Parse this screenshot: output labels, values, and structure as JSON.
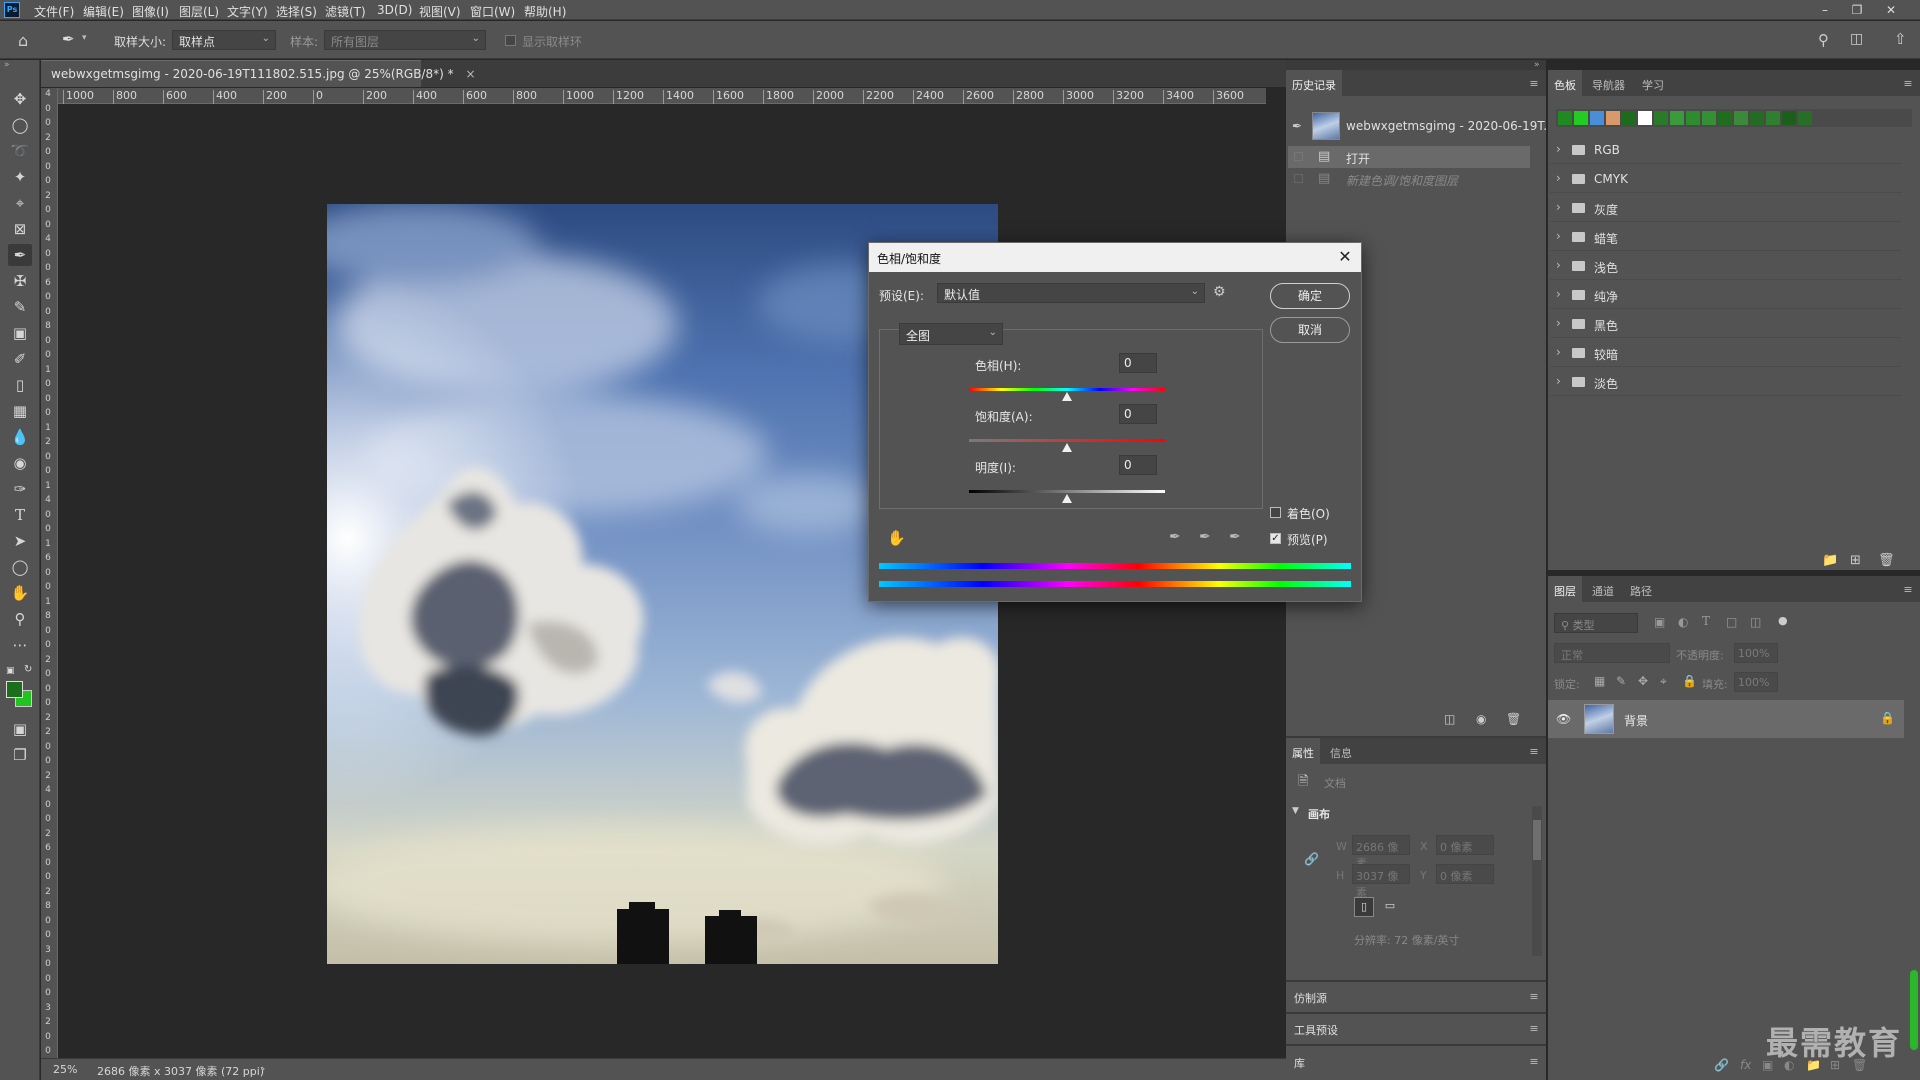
{
  "menubar": {
    "app_logo": "Ps",
    "items": [
      "文件(F)",
      "编辑(E)",
      "图像(I)",
      "图层(L)",
      "文字(Y)",
      "选择(S)",
      "滤镜(T)",
      "3D(D)",
      "视图(V)",
      "窗口(W)",
      "帮助(H)"
    ]
  },
  "options_bar": {
    "sample_size_label": "取样大小:",
    "sample_size_value": "取样点",
    "sample_label": "样本:",
    "sample_value": "所有图层",
    "show_ring_label": "显示取样环"
  },
  "document": {
    "tab_title": "webwxgetmsgimg - 2020-06-19T111802.515.jpg @ 25%(RGB/8*) *",
    "close_glyph": "×",
    "ruler_h_labels": [
      "1000",
      "800",
      "600",
      "400",
      "200",
      "0",
      "200",
      "400",
      "600",
      "800",
      "1000",
      "1200",
      "1400",
      "1600",
      "1800",
      "2000",
      "2200",
      "2400",
      "2600",
      "2800",
      "3000",
      "3200",
      "3400",
      "3600"
    ],
    "ruler_v_labels": [
      "4",
      "0",
      "0",
      "2",
      "0",
      "0",
      "0",
      "2",
      "0",
      "0",
      "4",
      "0",
      "0",
      "6",
      "0",
      "0",
      "8",
      "0",
      "0",
      "1",
      "0",
      "0",
      "0",
      "1",
      "2",
      "0",
      "0",
      "1",
      "4",
      "0",
      "0",
      "1",
      "6",
      "0",
      "0",
      "1",
      "8",
      "0",
      "0",
      "2",
      "0",
      "0",
      "0",
      "2",
      "2",
      "0",
      "0",
      "2",
      "4",
      "0",
      "0",
      "2",
      "6",
      "0",
      "0",
      "2",
      "8",
      "0",
      "0",
      "3",
      "0",
      "0",
      "0",
      "3",
      "2",
      "0",
      "0"
    ]
  },
  "status": {
    "zoom": "25%",
    "doc_info": "2686 像素 x 3037 像素 (72 ppi)"
  },
  "history_panel": {
    "tab": "历史记录",
    "snapshot_name": "webwxgetmsgimg - 2020-06-19T...",
    "steps": [
      "打开",
      "新建色调/饱和度图层"
    ]
  },
  "swatches_panel": {
    "tabs": [
      "色板",
      "导航器",
      "学习"
    ],
    "recent_colors": [
      "#1f8a1f",
      "#22cc22",
      "#4a8fd6",
      "#d89a6a",
      "#1d6b1d",
      "#ffffff",
      "#2a7a2a",
      "#3b9a3b",
      "#2e8b2e",
      "#358f35",
      "#1e6e1e",
      "#3a8a3a",
      "#246c24",
      "#2f7f2f",
      "#1b5f1b",
      "#276f27"
    ],
    "groups": [
      "RGB",
      "CMYK",
      "灰度",
      "蜡笔",
      "浅色",
      "纯净",
      "黑色",
      "较暗",
      "淡色"
    ]
  },
  "layers_panel": {
    "tabs": [
      "图层",
      "通道",
      "路径"
    ],
    "filter_placeholder": "类型",
    "blend_mode": "正常",
    "opacity_label": "不透明度:",
    "opacity_value": "100%",
    "lock_label": "锁定:",
    "fill_label": "填充:",
    "fill_value": "100%",
    "layer_name": "背景"
  },
  "properties_panel": {
    "tabs": [
      "属性",
      "信息"
    ],
    "doc_label": "文档",
    "section": "画布",
    "w_label": "W",
    "w_value": "2686 像素",
    "h_label": "H",
    "h_value": "3037 像素",
    "x_label": "X",
    "x_value": "0 像素",
    "y_label": "Y",
    "y_value": "0 像素",
    "resolution": "分辨率: 72 像素/英寸"
  },
  "collapsed_panels": [
    "仿制源",
    "工具预设",
    "库"
  ],
  "dialog": {
    "title": "色相/饱和度",
    "preset_label": "预设(E):",
    "preset_value": "默认值",
    "channel_value": "全图",
    "hue_label": "色相(H):",
    "hue_value": "0",
    "saturation_label": "饱和度(A):",
    "saturation_value": "0",
    "lightness_label": "明度(I):",
    "lightness_value": "0",
    "ok_label": "确定",
    "cancel_label": "取消",
    "colorize_label": "着色(O)",
    "colorize_checked": false,
    "preview_label": "预览(P)",
    "preview_checked": true,
    "hue_slider_level": 0.5,
    "saturation_slider_level": 0.5,
    "lightness_slider_level": 0.5
  },
  "watermark": "最需教育"
}
